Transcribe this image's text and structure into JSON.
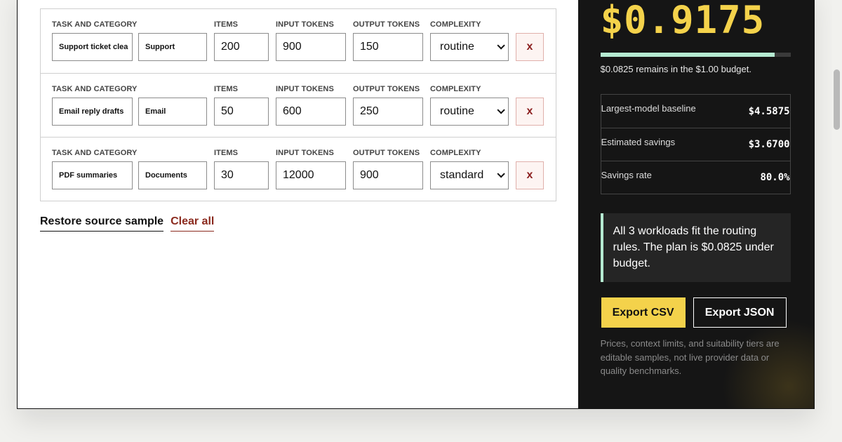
{
  "labels": {
    "task": "TASK AND CATEGORY",
    "items": "ITEMS",
    "input_tokens": "INPUT TOKENS",
    "output_tokens": "OUTPUT TOKENS",
    "complexity": "COMPLEXITY",
    "remove": "x"
  },
  "workloads": [
    {
      "task": "Support ticket clea",
      "category": "Support",
      "items": "200",
      "input": "900",
      "output": "150",
      "complexity": "routine"
    },
    {
      "task": "Email reply drafts",
      "category": "Email",
      "items": "50",
      "input": "600",
      "output": "250",
      "complexity": "routine"
    },
    {
      "task": "PDF summaries",
      "category": "Documents",
      "items": "30",
      "input": "12000",
      "output": "900",
      "complexity": "standard"
    }
  ],
  "actions": {
    "restore": "Restore source sample",
    "clear": "Clear all"
  },
  "summary": {
    "total": "$0.9175",
    "budget_used_fraction": 0.9175,
    "remains": "$0.0825 remains in the $1.00 budget.",
    "stats": [
      {
        "label": "Largest-model baseline",
        "value": "$4.5875"
      },
      {
        "label": "Estimated savings",
        "value": "$3.6700"
      },
      {
        "label": "Savings rate",
        "value": "80.0%"
      }
    ],
    "note": "All 3 workloads fit the routing rules. The plan is $0.0825 under budget.",
    "export_csv": "Export CSV",
    "export_json": "Export JSON",
    "disclaimer": "Prices, context limits, and suitability tiers are editable samples, not live provider data or quality benchmarks."
  },
  "colors": {
    "accent": "#f4d24b",
    "progress": "#b5ead1",
    "danger": "#8b1e1e",
    "panel": "#151515"
  }
}
